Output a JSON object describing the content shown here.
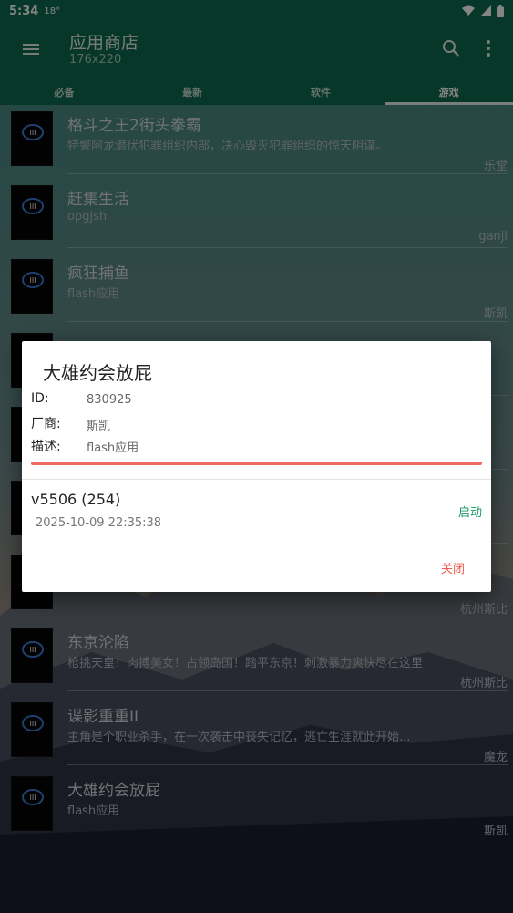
{
  "status": {
    "time": "5:34",
    "temp": "18°"
  },
  "appbar": {
    "title": "应用商店",
    "subtitle": "176x220"
  },
  "icons": {
    "menu": "menu-icon",
    "search": "search-icon",
    "more": "more-vert-icon"
  },
  "tabs": [
    {
      "label": "必备"
    },
    {
      "label": "最新"
    },
    {
      "label": "软件"
    },
    {
      "label": "游戏",
      "active": true
    }
  ],
  "list": [
    {
      "name": "格斗之王2街头拳霸",
      "desc": "特警阿龙潜伏犯罪组织内部，决心毁灭犯罪组织的惊天阴谋。",
      "vendor": "乐堂"
    },
    {
      "name": "赶集生活",
      "desc": "opgjsh",
      "vendor": "ganji"
    },
    {
      "name": "疯狂捕鱼",
      "desc": "flash应用",
      "vendor": "斯凯"
    },
    {
      "name": "",
      "desc": "",
      "vendor": ""
    },
    {
      "name": "",
      "desc": "",
      "vendor": ""
    },
    {
      "name": "",
      "desc": "",
      "vendor": ""
    },
    {
      "name": "",
      "desc": "",
      "vendor": "杭州斯比"
    },
    {
      "name": "东京沦陷",
      "desc": "枪挑天皇！肉搏美女！占领岛国！踏平东京！刺激暴力爽快尽在这里",
      "vendor": "杭州斯比"
    },
    {
      "name": "谍影重重II",
      "desc": "主角是个职业杀手，在一次袭击中丧失记忆，逃亡生涯就此开始...",
      "vendor": "魔龙"
    },
    {
      "name": "大雄约会放屁",
      "desc": "flash应用",
      "vendor": "斯凯"
    }
  ],
  "dialog": {
    "title": "大雄约会放屁",
    "id_label": "ID:",
    "id_value": "830925",
    "vendor_label": "厂商:",
    "vendor_value": "斯凯",
    "desc_label": "描述:",
    "desc_value": "flash应用",
    "progress_fraction": 1.0,
    "version": "v5506 (254)",
    "date": "2025-10-09 22:35:38",
    "launch_label": "启动",
    "close_label": "关闭"
  },
  "colors": {
    "primary": "#0c6a4d",
    "accent_green": "#1b9967",
    "progress_red": "#ef6a61",
    "close_red": "#ef5a52"
  }
}
